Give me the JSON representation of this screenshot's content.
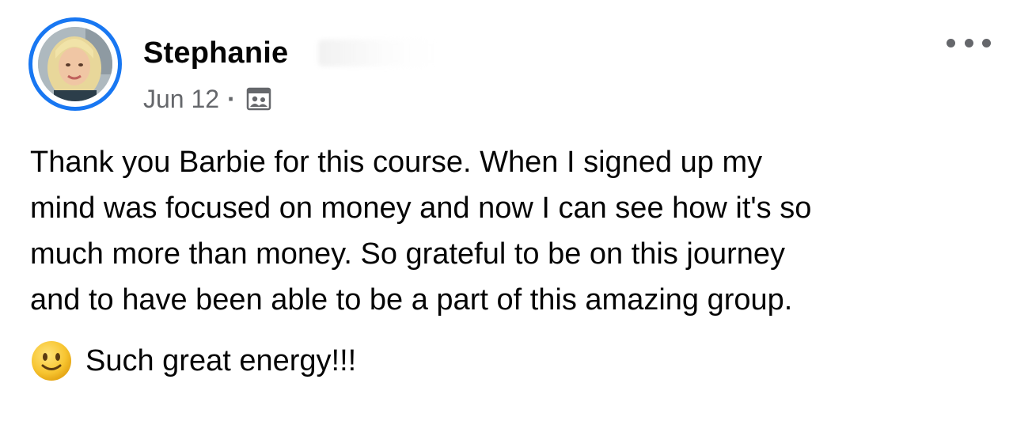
{
  "post": {
    "author": "Stephanie",
    "date": "Jun 12",
    "separator": "·",
    "audience_icon": "group-members-icon",
    "menu_icon": "more-options-icon",
    "avatar_icon": "profile-photo",
    "body_lines": [
      "Thank you Barbie for this course. When I signed up my",
      "mind was focused on money and now I can see how it's so",
      "much more than money. So grateful to be on this journey",
      "and to have been able to be a part of this amazing group."
    ],
    "closing_emoji": "slightly-smiling-face-icon",
    "closing_text": "Such great energy!!!"
  },
  "colors": {
    "ring": "#1877f2",
    "text": "#050505",
    "secondary_text": "#65676b",
    "emoji_face": "#f7c531"
  }
}
